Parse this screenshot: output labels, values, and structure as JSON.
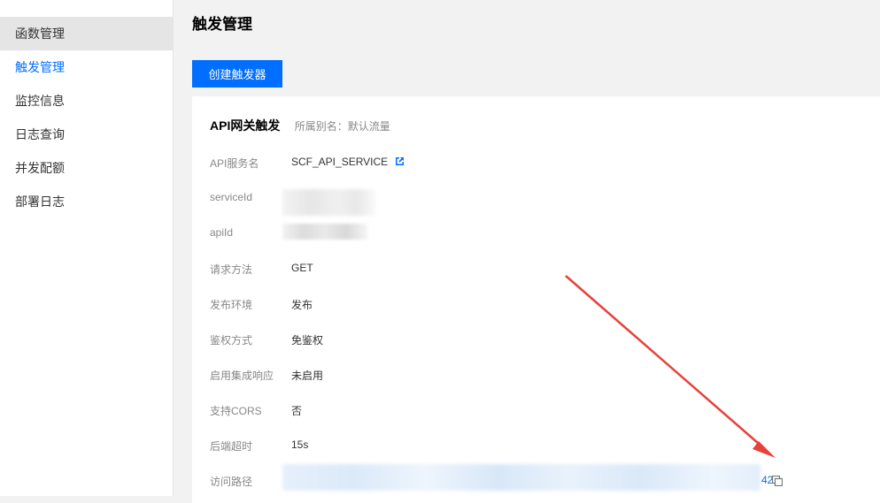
{
  "sidebar": {
    "items": [
      {
        "label": "函数管理"
      },
      {
        "label": "触发管理"
      },
      {
        "label": "监控信息"
      },
      {
        "label": "日志查询"
      },
      {
        "label": "并发配额"
      },
      {
        "label": "部署日志"
      }
    ]
  },
  "main": {
    "title": "触发管理",
    "create_button": "创建触发器"
  },
  "trigger": {
    "title": "API网关触发",
    "alias": "所属别名：默认流量",
    "rows": [
      {
        "label": "API服务名",
        "value": "SCF_API_SERVICE"
      },
      {
        "label": "serviceId",
        "value": ""
      },
      {
        "label": "apiId",
        "value": ""
      },
      {
        "label": "请求方法",
        "value": "GET"
      },
      {
        "label": "发布环境",
        "value": "发布"
      },
      {
        "label": "鉴权方式",
        "value": "免鉴权"
      },
      {
        "label": "启用集成响应",
        "value": "未启用"
      },
      {
        "label": "支持CORS",
        "value": "否"
      },
      {
        "label": "后端超时",
        "value": "15s"
      },
      {
        "label": "访问路径",
        "value": "42"
      }
    ]
  },
  "icons": {
    "external_link": "external-link-icon",
    "copy": "copy-icon"
  },
  "colors": {
    "accent": "#006eff",
    "annotation_arrow": "#e8403a"
  }
}
